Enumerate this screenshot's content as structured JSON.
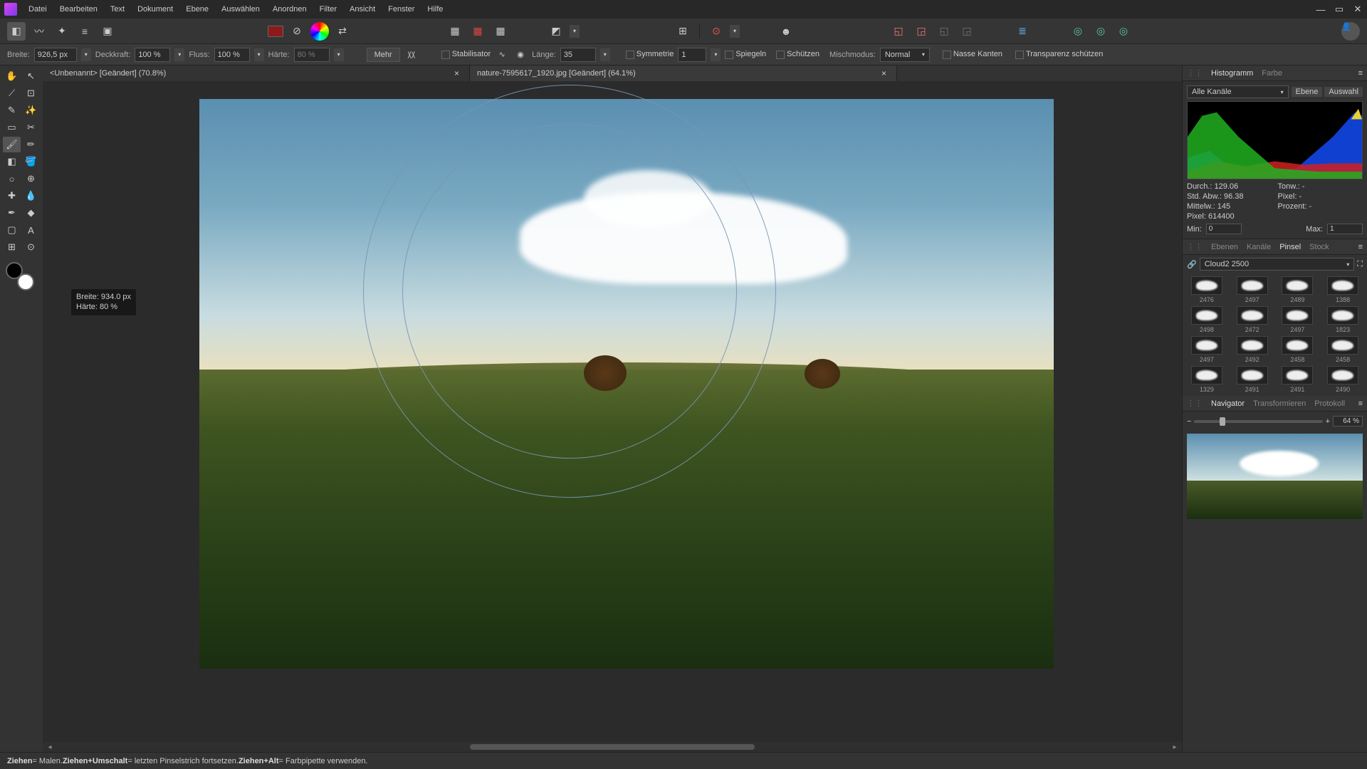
{
  "menu": [
    "Datei",
    "Bearbeiten",
    "Text",
    "Dokument",
    "Ebene",
    "Auswählen",
    "Anordnen",
    "Filter",
    "Ansicht",
    "Fenster",
    "Hilfe"
  ],
  "context": {
    "width_label": "Breite:",
    "width_value": "926,5 px",
    "opacity_label": "Deckkraft:",
    "opacity_value": "100 %",
    "flow_label": "Fluss:",
    "flow_value": "100 %",
    "hardness_label": "Härte:",
    "hardness_value": "80 %",
    "more": "Mehr",
    "stabilizer": "Stabilisator",
    "length_label": "Länge:",
    "length_value": "35",
    "symmetry": "Symmetrie",
    "symmetry_value": "1",
    "mirror": "Spiegeln",
    "protect": "Schützen",
    "blend_label": "Mischmodus:",
    "blend_value": "Normal",
    "wet": "Nasse Kanten",
    "transparency": "Transparenz schützen"
  },
  "tabs": [
    {
      "title": "<Unbenannt> [Geändert] (70.8%)",
      "active": false
    },
    {
      "title": "nature-7595617_1920.jpg [Geändert] (64.1%)",
      "active": true
    }
  ],
  "tooltip": {
    "width": "Breite: 934.0 px",
    "hardness": "Härte: 80 %"
  },
  "panels": {
    "histogram": {
      "tabs": [
        "Histogramm",
        "Farbe"
      ],
      "channel": "Alle Kanäle",
      "btns": [
        "Ebene",
        "Auswahl"
      ],
      "stats": {
        "durchschnitt": "Durch.: 129.06",
        "stdabw": "Std. Abw.: 96.38",
        "mittelw": "Mittelw.: 145",
        "pixel": "Pixel: 614400",
        "tonw": "Tonw.: -",
        "prozent": "Prozent: -"
      },
      "min_label": "Min:",
      "min": "0",
      "max_label": "Max:",
      "max": "1",
      "pixel_label": "Pixel: -"
    },
    "layers": {
      "tabs": [
        "Ebenen",
        "Kanäle",
        "Pinsel",
        "Stock"
      ],
      "active": "Pinsel",
      "brush_set": "Cloud2 2500",
      "brushes": [
        "2476",
        "2497",
        "2489",
        "1388",
        "2498",
        "2472",
        "2497",
        "1823",
        "2497",
        "2492",
        "2458",
        "2458",
        "1329",
        "2491",
        "2491",
        "2490"
      ]
    },
    "navigator": {
      "tabs": [
        "Navigator",
        "Transformieren",
        "Protokoll"
      ],
      "zoom": "64 %"
    }
  },
  "status": {
    "s1": "Ziehen",
    "t1": " = Malen. ",
    "s2": "Ziehen+Umschalt",
    "t2": " = letzten Pinselstrich fortsetzen. ",
    "s3": "Ziehen+Alt",
    "t3": " = Farbpipette verwenden."
  }
}
